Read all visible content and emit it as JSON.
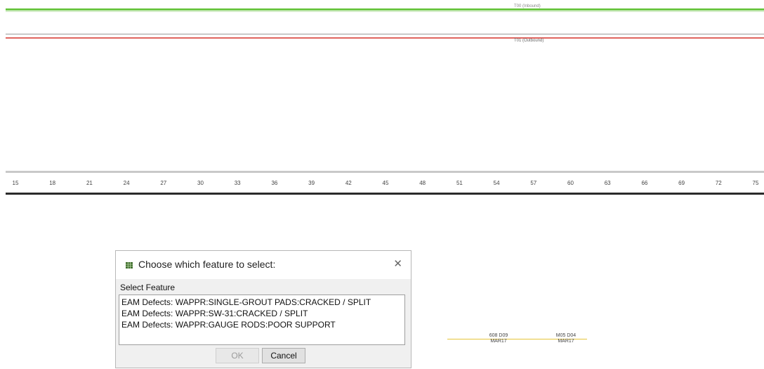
{
  "tracks": {
    "inbound_label": "T00 (Inbound)",
    "outbound_label": "T01 (Outbound)",
    "inbound_color": "#6cc644",
    "outbound_color": "#e0655f"
  },
  "ruler": {
    "ticks": [
      "15",
      "18",
      "21",
      "24",
      "27",
      "30",
      "33",
      "36",
      "39",
      "42",
      "45",
      "48",
      "51",
      "54",
      "57",
      "60",
      "63",
      "66",
      "69",
      "72",
      "75"
    ]
  },
  "chainage": {
    "left_top": "608 D09",
    "left_bottom": "MAR17",
    "right_top": "M05 D04",
    "right_bottom": "MAR17",
    "line_color": "#e6c43a"
  },
  "dialog": {
    "icon": "table-grid-icon",
    "title": "Choose which feature to select:",
    "close_glyph": "✕",
    "group_label": "Select Feature",
    "features": [
      "EAM Defects: WAPPR:SINGLE-GROUT PADS:CRACKED / SPLIT",
      "EAM Defects: WAPPR:SW-31:CRACKED / SPLIT",
      "EAM Defects: WAPPR:GAUGE RODS:POOR SUPPORT"
    ],
    "ok_label": "OK",
    "cancel_label": "Cancel"
  }
}
